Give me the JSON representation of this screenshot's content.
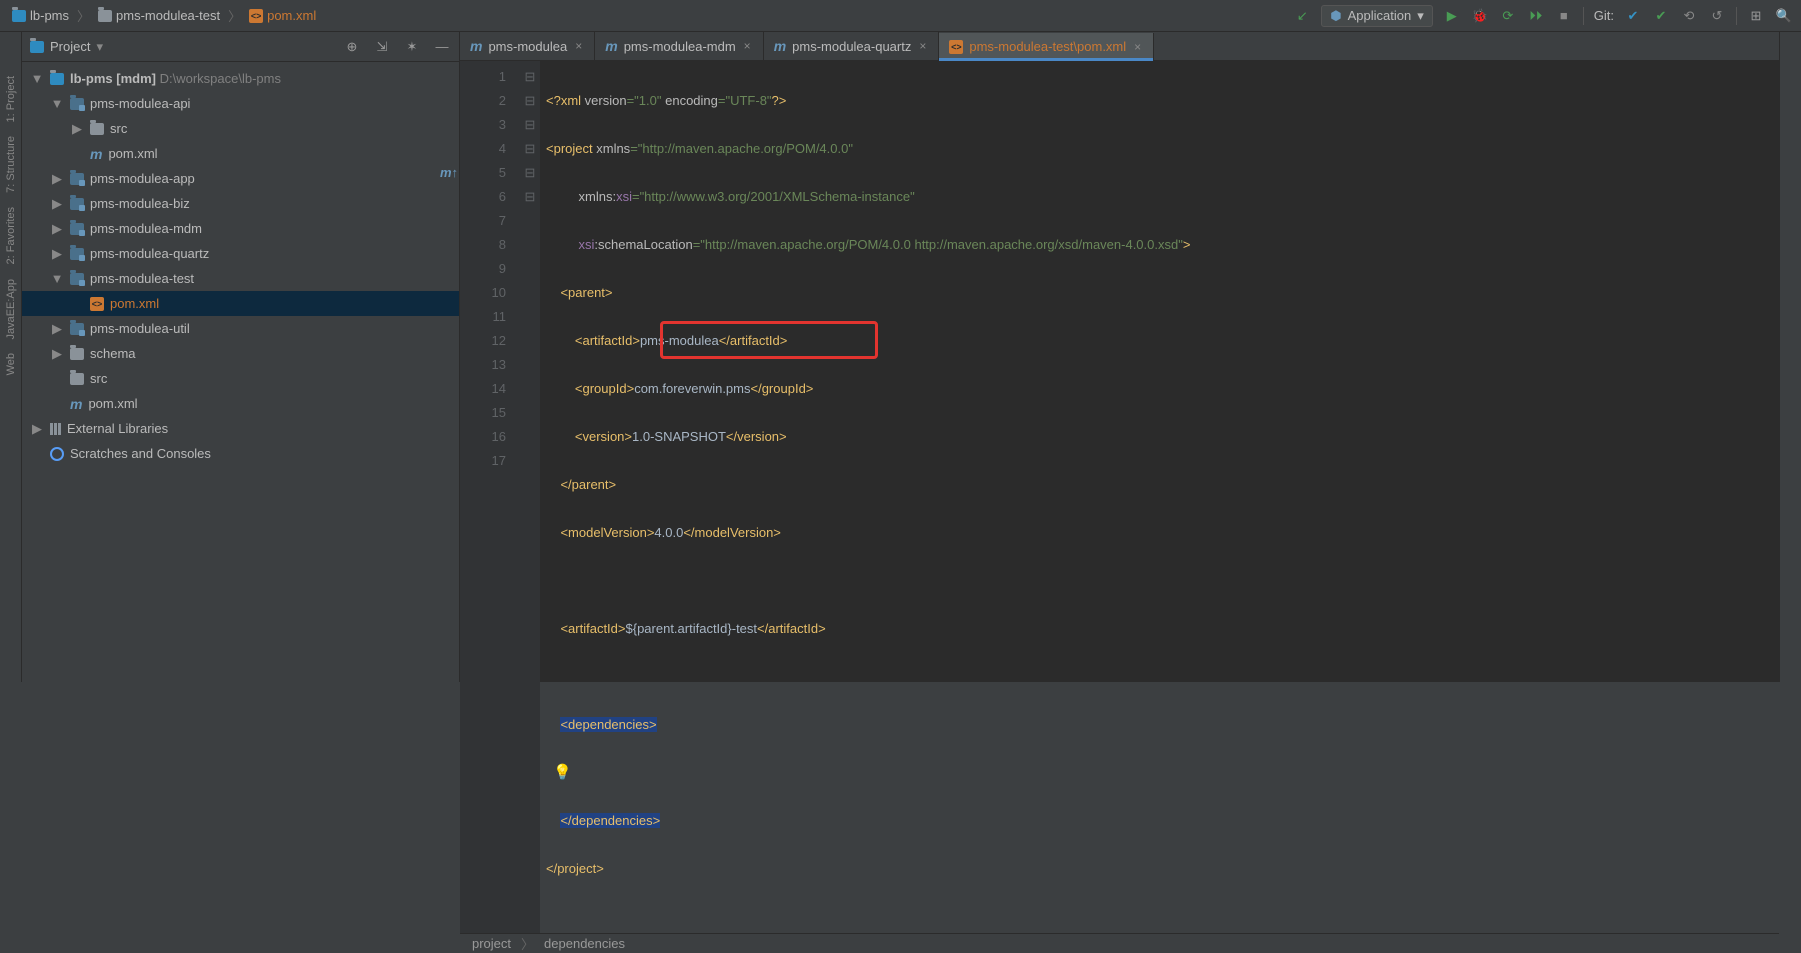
{
  "breadcrumbs": [
    {
      "label": "lb-pms",
      "icon": "folder-proj"
    },
    {
      "label": "pms-modulea-test",
      "icon": "folder"
    },
    {
      "label": "pom.xml",
      "icon": "mfile",
      "active": true
    }
  ],
  "run_config": "Application",
  "git_label": "Git:",
  "project_panel": {
    "title": "Project"
  },
  "tree": {
    "root": {
      "name": "lb-pms",
      "suffix": "[mdm]",
      "path": "D:\\workspace\\lb-pms"
    },
    "nodes": [
      {
        "d": 1,
        "tw": "▼",
        "icon": "mod",
        "label": "pms-modulea-api"
      },
      {
        "d": 2,
        "tw": "▶",
        "icon": "folder",
        "label": "src"
      },
      {
        "d": 2,
        "tw": "",
        "icon": "m",
        "label": "pom.xml"
      },
      {
        "d": 1,
        "tw": "▶",
        "icon": "mod",
        "label": "pms-modulea-app"
      },
      {
        "d": 1,
        "tw": "▶",
        "icon": "mod",
        "label": "pms-modulea-biz"
      },
      {
        "d": 1,
        "tw": "▶",
        "icon": "mod",
        "label": "pms-modulea-mdm"
      },
      {
        "d": 1,
        "tw": "▶",
        "icon": "mod",
        "label": "pms-modulea-quartz"
      },
      {
        "d": 1,
        "tw": "▼",
        "icon": "mod",
        "label": "pms-modulea-test"
      },
      {
        "d": 2,
        "tw": "",
        "icon": "mfile",
        "label": "pom.xml",
        "sel": true,
        "red": true
      },
      {
        "d": 1,
        "tw": "▶",
        "icon": "mod",
        "label": "pms-modulea-util"
      },
      {
        "d": 1,
        "tw": "▶",
        "icon": "folder",
        "label": "schema"
      },
      {
        "d": 1,
        "tw": "",
        "icon": "folder",
        "label": "src"
      },
      {
        "d": 1,
        "tw": "",
        "icon": "m",
        "label": "pom.xml"
      }
    ],
    "ext_lib": "External Libraries",
    "scratches": "Scratches and Consoles"
  },
  "tabs": [
    {
      "label": "pms-modulea",
      "icon": "m"
    },
    {
      "label": "pms-modulea-mdm",
      "icon": "m"
    },
    {
      "label": "pms-modulea-quartz",
      "icon": "m"
    },
    {
      "label": "pms-modulea-test\\pom.xml",
      "icon": "mfile",
      "active": true
    }
  ],
  "code": {
    "line1": {
      "pre": "<?xml ",
      "a1": "version",
      "v1": "\"1.0\"",
      "a2": "encoding",
      "v2": "\"UTF-8\"",
      "post": "?>"
    },
    "line2": {
      "tag": "<project ",
      "a": "xmlns",
      "v": "\"http://maven.apache.org/POM/4.0.0\""
    },
    "line3": {
      "a": "xmlns:",
      "ns": "xsi",
      "v": "\"http://www.w3.org/2001/XMLSchema-instance\""
    },
    "line4": {
      "ns": "xsi",
      "a": ":schemaLocation",
      "v": "\"http://maven.apache.org/POM/4.0.0 http://maven.apache.org/xsd/maven-4.0.0.xsd\"",
      "post": ">"
    },
    "parent_open": "<parent>",
    "artifact": {
      "o": "<artifactId>",
      "v": "pms-modulea",
      "c": "</artifactId>"
    },
    "group": {
      "o": "<groupId>",
      "v": "com.foreverwin.pms",
      "c": "</groupId>"
    },
    "version": {
      "o": "<version>",
      "v": "1.0-SNAPSHOT",
      "c": "</version>"
    },
    "parent_close": "</parent>",
    "modelv": {
      "o": "<modelVersion>",
      "v": "4.0.0",
      "c": "</modelVersion>"
    },
    "artid": {
      "o": "<artifactId>",
      "v": "${parent.artifactId}-test",
      "c": "</artifactId>"
    },
    "deps_open": "<dependencies>",
    "deps_close": "</dependencies>",
    "proj_close": "</project>"
  },
  "breadcrumb_nav": {
    "a": "project",
    "b": "dependencies"
  },
  "line_numbers": [
    "1",
    "2",
    "3",
    "4",
    "5",
    "6",
    "7",
    "8",
    "9",
    "10",
    "11",
    "12",
    "13",
    "14",
    "15",
    "16",
    "17"
  ],
  "fold": [
    "",
    "⊟",
    "",
    "",
    "⊟",
    "",
    "",
    "",
    "⊟",
    "",
    "",
    "",
    "",
    "⊟",
    "",
    "⊟",
    "⊟"
  ],
  "side_tabs": {
    "project": "1: Project",
    "structure": "7: Structure",
    "favorites": "2: Favorites",
    "jee": "JavaEE:App",
    "web": "Web"
  }
}
